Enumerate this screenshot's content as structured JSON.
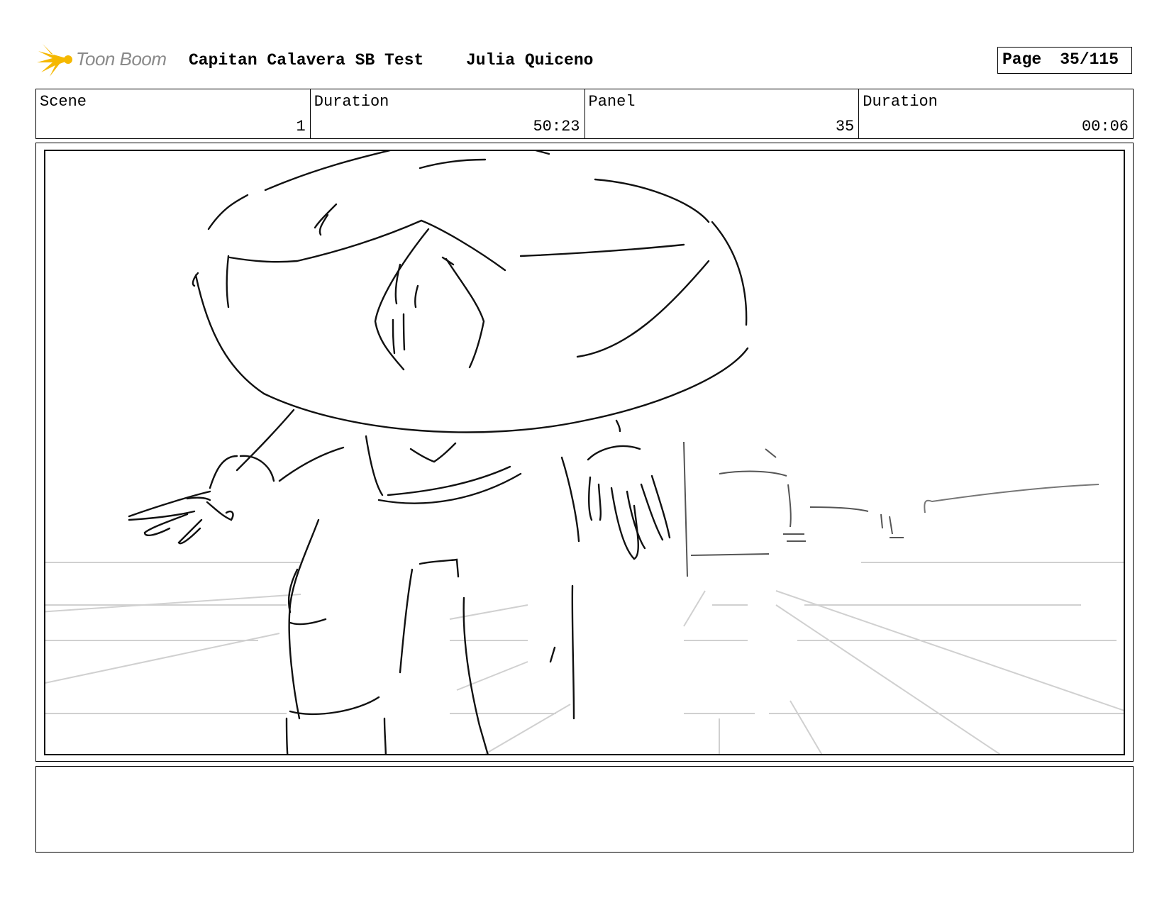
{
  "header": {
    "logo_text": "Toon Boom",
    "project_title": "Capitan Calavera SB Test",
    "artist": "Julia Quiceno",
    "page_label": "Page",
    "page_value": "35/115"
  },
  "info": {
    "scene": {
      "label": "Scene",
      "value": "1"
    },
    "scene_duration": {
      "label": "Duration",
      "value": "50:23"
    },
    "panel": {
      "label": "Panel",
      "value": "35"
    },
    "panel_duration": {
      "label": "Duration",
      "value": "00:06"
    }
  },
  "notes": {
    "text": ""
  },
  "colors": {
    "logo_yellow": "#f5b800",
    "logo_text": "#8a8a8a",
    "sketch_line": "#111111",
    "guide_line": "#d0d0d0"
  }
}
